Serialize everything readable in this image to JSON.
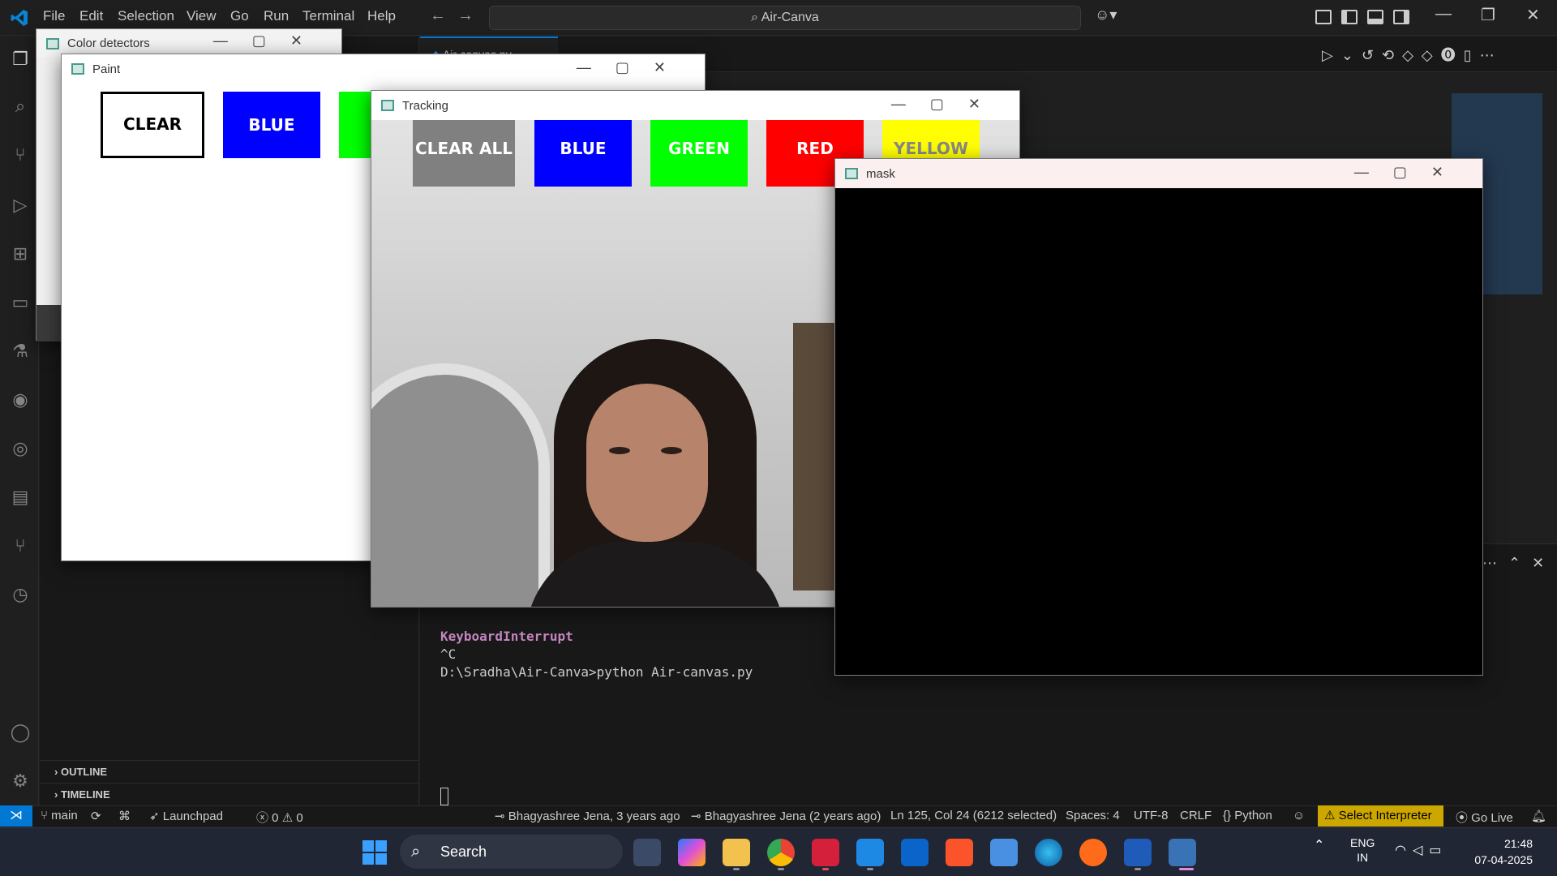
{
  "vscode": {
    "menu": [
      "File",
      "Edit",
      "Selection",
      "View",
      "Go",
      "Run",
      "Terminal",
      "Help"
    ],
    "command_center": "Air-Canva",
    "editor_tab": "Air-canvas.py",
    "sidebar_sections": [
      "OUTLINE",
      "TIMELINE"
    ],
    "terminal_lines": [
      "KeyboardInterrupt",
      "^C",
      "D:\\Sradha\\Air-Canva>python Air-canvas.py"
    ],
    "statusbar": {
      "branch": "main",
      "launchpad": "Launchpad",
      "errors": "0",
      "warnings": "0",
      "blame1": "Bhagyashree Jena, 3 years ago",
      "blame2": "Bhagyashree Jena (2 years ago)",
      "cursor": "Ln 125, Col 24 (6212 selected)",
      "spaces": "Spaces: 4",
      "encoding": "UTF-8",
      "eol": "CRLF",
      "language": "Python",
      "interpreter": "Select Interpreter",
      "go_live": "Go Live"
    }
  },
  "windows": {
    "color_detectors": {
      "title": "Color detectors"
    },
    "paint": {
      "title": "Paint",
      "buttons": [
        "CLEAR",
        "BLUE"
      ]
    },
    "tracking": {
      "title": "Tracking",
      "buttons": [
        "CLEAR ALL",
        "BLUE",
        "GREEN",
        "RED",
        "YELLOW"
      ]
    },
    "mask": {
      "title": "mask"
    }
  },
  "taskbar": {
    "search_label": "Search",
    "lang_line1": "ENG",
    "lang_line2": "IN",
    "time": "21:48",
    "date": "07-04-2025"
  },
  "colors": {
    "blue": "#0000ff",
    "green": "#00ff00",
    "red": "#ff0000",
    "yellow": "#ffff00",
    "gray": "#808080",
    "vscode_accent": "#0078d4",
    "interpreter_warning": "#cca700"
  }
}
